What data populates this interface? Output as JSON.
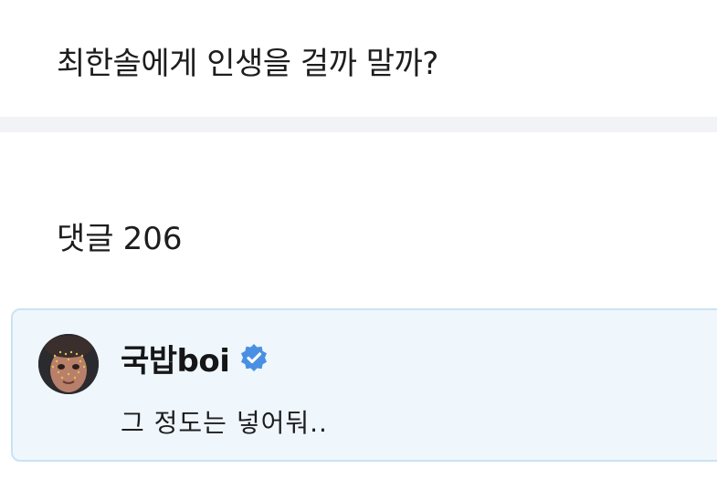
{
  "post": {
    "title": "최한솔에게 인생을 걸까 말까?"
  },
  "comments": {
    "label": "댓글",
    "count": "206",
    "items": [
      {
        "author": "국밥boi",
        "verified": true,
        "text": "그 정도는 넣어둬.."
      }
    ]
  },
  "colors": {
    "card_background": "#eff7fd",
    "card_border": "#c9e3f4",
    "verified_badge": "#4a90e2",
    "divider": "#f2f3f7"
  }
}
